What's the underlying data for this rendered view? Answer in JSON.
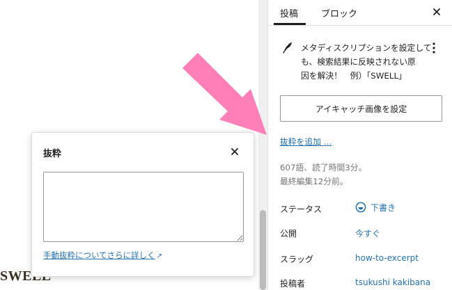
{
  "canvas": {
    "logo_text": "SWELL"
  },
  "excerpt_popover": {
    "title": "抜粋",
    "textarea_value": "",
    "manual_link_text": "手動抜粋についてさらに詳しく",
    "manual_link_icon": "↗"
  },
  "sidebar": {
    "tabs": [
      {
        "label": "投稿",
        "active": true
      },
      {
        "label": "ブロック",
        "active": false
      }
    ],
    "post_title_lines": [
      "メタディスクリプションを設定して",
      "も、検索結果に反映されない原",
      "因を解決！　例）「SWELL」"
    ],
    "featured_image_button": "アイキャッチ画像を設定",
    "add_excerpt_link": "抜粋を追加 …",
    "stats": [
      "607語、読了時間3分。",
      "最終編集12分前。"
    ],
    "rows": [
      {
        "label": "ステータス",
        "value": "下書き"
      },
      {
        "label": "公開",
        "value": "今すぐ"
      },
      {
        "label": "スラッグ",
        "value": "how-to-excerpt"
      },
      {
        "label": "投稿者",
        "value": "tsukushi kakibana"
      }
    ]
  },
  "overlay": {
    "arrow_color": "#ff80b8"
  }
}
